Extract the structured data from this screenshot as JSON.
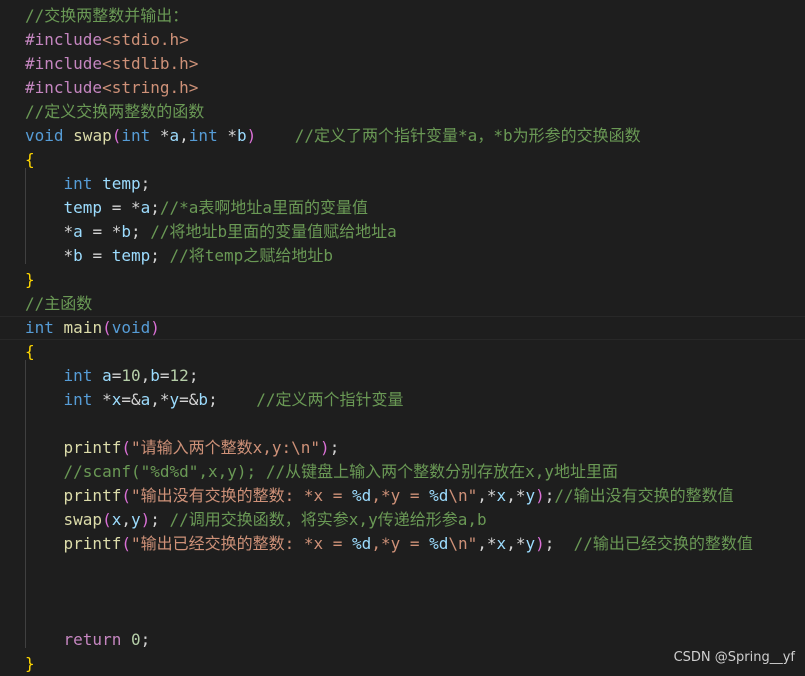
{
  "editor": {
    "language": "c",
    "lines": [
      [
        {
          "t": "comment",
          "v": "//交换两整数并输出："
        }
      ],
      [
        {
          "t": "macro",
          "v": "#include"
        },
        {
          "t": "include",
          "v": "<stdio.h>"
        }
      ],
      [
        {
          "t": "macro",
          "v": "#include"
        },
        {
          "t": "include",
          "v": "<stdlib.h>"
        }
      ],
      [
        {
          "t": "macro",
          "v": "#include"
        },
        {
          "t": "include",
          "v": "<string.h>"
        }
      ],
      [
        {
          "t": "comment",
          "v": "//定义交换两整数的函数"
        }
      ],
      [
        {
          "t": "type",
          "v": "void"
        },
        {
          "t": "plain",
          "v": " "
        },
        {
          "t": "func",
          "v": "swap"
        },
        {
          "t": "paren",
          "v": "("
        },
        {
          "t": "type",
          "v": "int"
        },
        {
          "t": "plain",
          "v": " *"
        },
        {
          "t": "var",
          "v": "a"
        },
        {
          "t": "plain",
          "v": ","
        },
        {
          "t": "type",
          "v": "int"
        },
        {
          "t": "plain",
          "v": " *"
        },
        {
          "t": "var",
          "v": "b"
        },
        {
          "t": "paren",
          "v": ")"
        },
        {
          "t": "plain",
          "v": "    "
        },
        {
          "t": "comment",
          "v": "//定义了两个指针变量*a，*b为形参的交换函数"
        }
      ],
      [
        {
          "t": "bracket",
          "v": "{"
        }
      ],
      [
        {
          "t": "plain",
          "v": "    "
        },
        {
          "t": "type",
          "v": "int"
        },
        {
          "t": "plain",
          "v": " "
        },
        {
          "t": "var",
          "v": "temp"
        },
        {
          "t": "plain",
          "v": ";"
        }
      ],
      [
        {
          "t": "plain",
          "v": "    "
        },
        {
          "t": "var",
          "v": "temp"
        },
        {
          "t": "plain",
          "v": " = *"
        },
        {
          "t": "var",
          "v": "a"
        },
        {
          "t": "plain",
          "v": ";"
        },
        {
          "t": "comment",
          "v": "//*a表啊地址a里面的变量值"
        }
      ],
      [
        {
          "t": "plain",
          "v": "    *"
        },
        {
          "t": "var",
          "v": "a"
        },
        {
          "t": "plain",
          "v": " = *"
        },
        {
          "t": "var",
          "v": "b"
        },
        {
          "t": "plain",
          "v": "; "
        },
        {
          "t": "comment",
          "v": "//将地址b里面的变量值赋给地址a"
        }
      ],
      [
        {
          "t": "plain",
          "v": "    *"
        },
        {
          "t": "var",
          "v": "b"
        },
        {
          "t": "plain",
          "v": " = "
        },
        {
          "t": "var",
          "v": "temp"
        },
        {
          "t": "plain",
          "v": "; "
        },
        {
          "t": "comment",
          "v": "//将temp之赋给地址b"
        }
      ],
      [
        {
          "t": "bracket",
          "v": "}"
        }
      ],
      [
        {
          "t": "comment",
          "v": "//主函数"
        }
      ],
      [
        {
          "t": "type",
          "v": "int"
        },
        {
          "t": "plain",
          "v": " "
        },
        {
          "t": "func",
          "v": "main"
        },
        {
          "t": "paren",
          "v": "("
        },
        {
          "t": "type",
          "v": "void"
        },
        {
          "t": "paren",
          "v": ")"
        }
      ],
      [
        {
          "t": "bracket",
          "v": "{"
        }
      ],
      [
        {
          "t": "plain",
          "v": "    "
        },
        {
          "t": "type",
          "v": "int"
        },
        {
          "t": "plain",
          "v": " "
        },
        {
          "t": "var",
          "v": "a"
        },
        {
          "t": "plain",
          "v": "="
        },
        {
          "t": "num",
          "v": "10"
        },
        {
          "t": "plain",
          "v": ","
        },
        {
          "t": "var",
          "v": "b"
        },
        {
          "t": "plain",
          "v": "="
        },
        {
          "t": "num",
          "v": "12"
        },
        {
          "t": "plain",
          "v": ";"
        }
      ],
      [
        {
          "t": "plain",
          "v": "    "
        },
        {
          "t": "type",
          "v": "int"
        },
        {
          "t": "plain",
          "v": " *"
        },
        {
          "t": "var",
          "v": "x"
        },
        {
          "t": "plain",
          "v": "=&"
        },
        {
          "t": "var",
          "v": "a"
        },
        {
          "t": "plain",
          "v": ",*"
        },
        {
          "t": "var",
          "v": "y"
        },
        {
          "t": "plain",
          "v": "=&"
        },
        {
          "t": "var",
          "v": "b"
        },
        {
          "t": "plain",
          "v": ";    "
        },
        {
          "t": "comment",
          "v": "//定义两个指针变量"
        }
      ],
      [],
      [
        {
          "t": "plain",
          "v": "    "
        },
        {
          "t": "func",
          "v": "printf"
        },
        {
          "t": "paren",
          "v": "("
        },
        {
          "t": "str",
          "v": "\"请输入两个整数x,y:\\n\""
        },
        {
          "t": "paren",
          "v": ")"
        },
        {
          "t": "plain",
          "v": ";"
        }
      ],
      [
        {
          "t": "plain",
          "v": "    "
        },
        {
          "t": "comment",
          "v": "//scanf(\"%d%d\",x,y); //从键盘上输入两个整数分别存放在x,y地址里面"
        }
      ],
      [
        {
          "t": "plain",
          "v": "    "
        },
        {
          "t": "func",
          "v": "printf"
        },
        {
          "t": "paren",
          "v": "("
        },
        {
          "t": "str",
          "v": "\"输出没有交换的整数: *x = "
        },
        {
          "t": "fmt",
          "v": "%d"
        },
        {
          "t": "str",
          "v": ",*y = "
        },
        {
          "t": "fmt",
          "v": "%d"
        },
        {
          "t": "str",
          "v": "\\n\""
        },
        {
          "t": "plain",
          "v": ",*"
        },
        {
          "t": "var",
          "v": "x"
        },
        {
          "t": "plain",
          "v": ",*"
        },
        {
          "t": "var",
          "v": "y"
        },
        {
          "t": "paren",
          "v": ")"
        },
        {
          "t": "plain",
          "v": ";"
        },
        {
          "t": "comment",
          "v": "//输出没有交换的整数值"
        }
      ],
      [
        {
          "t": "plain",
          "v": "    "
        },
        {
          "t": "func",
          "v": "swap"
        },
        {
          "t": "paren",
          "v": "("
        },
        {
          "t": "var",
          "v": "x"
        },
        {
          "t": "plain",
          "v": ","
        },
        {
          "t": "var",
          "v": "y"
        },
        {
          "t": "paren",
          "v": ")"
        },
        {
          "t": "plain",
          "v": "; "
        },
        {
          "t": "comment",
          "v": "//调用交换函数，将实参x,y传递给形参a,b"
        }
      ],
      [
        {
          "t": "plain",
          "v": "    "
        },
        {
          "t": "func",
          "v": "printf"
        },
        {
          "t": "paren",
          "v": "("
        },
        {
          "t": "str",
          "v": "\"输出已经交换的整数: *x = "
        },
        {
          "t": "fmt",
          "v": "%d"
        },
        {
          "t": "str",
          "v": ",*y = "
        },
        {
          "t": "fmt",
          "v": "%d"
        },
        {
          "t": "str",
          "v": "\\n\""
        },
        {
          "t": "plain",
          "v": ",*"
        },
        {
          "t": "var",
          "v": "x"
        },
        {
          "t": "plain",
          "v": ",*"
        },
        {
          "t": "var",
          "v": "y"
        },
        {
          "t": "paren",
          "v": ")"
        },
        {
          "t": "plain",
          "v": ";  "
        },
        {
          "t": "comment",
          "v": "//输出已经交换的整数值"
        }
      ],
      [],
      [],
      [],
      [
        {
          "t": "plain",
          "v": "    "
        },
        {
          "t": "kw",
          "v": "return"
        },
        {
          "t": "plain",
          "v": " "
        },
        {
          "t": "num",
          "v": "0"
        },
        {
          "t": "plain",
          "v": ";"
        }
      ],
      [
        {
          "t": "bracket",
          "v": "}"
        }
      ]
    ]
  },
  "watermark": {
    "text": "CSDN @Spring__yf"
  },
  "colors": {
    "background": "#1e1e1e",
    "comment": "#6a9955",
    "keyword_type": "#569cd6",
    "function": "#dcdcaa",
    "variable": "#9cdcfe",
    "number": "#b5cea8",
    "string": "#ce9178",
    "macro": "#c586c0",
    "bracket": "#ffd700"
  }
}
